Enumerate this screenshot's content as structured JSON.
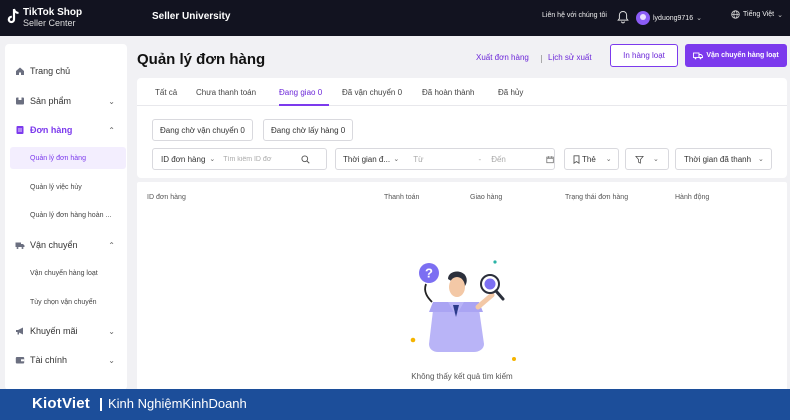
{
  "topbar": {
    "logo_line1": "TikTok Shop",
    "logo_line2": "Seller Center",
    "university": "Seller University",
    "contact": "Liên hệ với chúng tôi",
    "username": "lyduong9716",
    "language": "Tiếng Việt"
  },
  "sidebar": {
    "items": [
      {
        "label": "Trang chủ",
        "icon": "home-icon"
      },
      {
        "label": "Sản phẩm",
        "icon": "box-icon"
      },
      {
        "label": "Đơn hàng",
        "icon": "order-icon"
      },
      {
        "label": "Vận chuyển",
        "icon": "truck-icon"
      },
      {
        "label": "Khuyến mãi",
        "icon": "megaphone-icon"
      },
      {
        "label": "Tài chính",
        "icon": "wallet-icon"
      }
    ],
    "order_sub": [
      "Quản lý đơn hàng",
      "Quản lý việc hủy",
      "Quản lý đơn hàng hoàn ..."
    ],
    "shipping_sub": [
      "Vận chuyển hàng loạt",
      "Tùy chọn vận chuyển"
    ]
  },
  "header": {
    "title": "Quản lý đơn hàng",
    "export": "Xuất đơn hàng",
    "export_history": "Lịch sử xuất",
    "print_bulk": "In hàng loạt",
    "ship_bulk": "Vận chuyển hàng loạt"
  },
  "tabs": [
    "Tất cả",
    "Chưa thanh toán",
    "Đang giao 0",
    "Đã vận chuyển 0",
    "Đã hoàn thành",
    "Đã hủy"
  ],
  "status_chips": [
    "Đang chờ vận chuyển 0",
    "Đang chờ lấy hàng 0"
  ],
  "filters": {
    "id_select": "ID đơn hàng",
    "search_placeholder": "Tìm kiếm ID đơ",
    "time_select": "Thời gian đ...",
    "from": "Từ",
    "dash": "-",
    "to": "Đến",
    "tag": "Thẻ",
    "paid_time": "Thời gian đã thanh"
  },
  "table": {
    "headers": [
      "ID đơn hàng",
      "Thanh toán",
      "Giao hàng",
      "Trạng thái đơn hàng",
      "Hành động"
    ],
    "empty": "Không thấy kết quả tìm kiếm"
  },
  "footer": {
    "brand": "KiotViet",
    "tagline": "Kinh NghiệmKinhDoanh"
  },
  "colors": {
    "accent": "#7c3aed",
    "topbar": "#121320",
    "footer": "#1c4e9a"
  }
}
